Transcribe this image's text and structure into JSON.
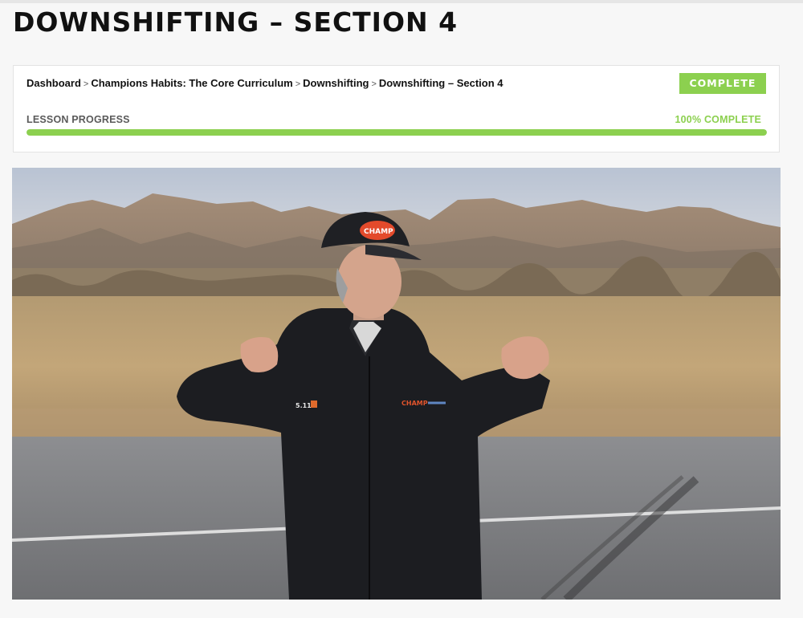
{
  "page": {
    "title": "DOWNSHIFTING – SECTION 4"
  },
  "breadcrumb": {
    "items": [
      "Dashboard",
      "Champions Habits: The Core Curriculum",
      "Downshifting",
      "Downshifting – Section 4"
    ],
    "separator": ">"
  },
  "status": {
    "button_label": "COMPLETE"
  },
  "progress": {
    "label": "LESSON PROGRESS",
    "percent_text": "100% COMPLETE",
    "value": 1.0
  },
  "video": {
    "cap_logo_text": "CHAMP",
    "jacket_badge_text": "5.11",
    "jacket_logo_text": "CHAMP"
  },
  "colors": {
    "accent_green": "#8cd04f",
    "title_text": "#111111",
    "background": "#f7f7f7"
  }
}
